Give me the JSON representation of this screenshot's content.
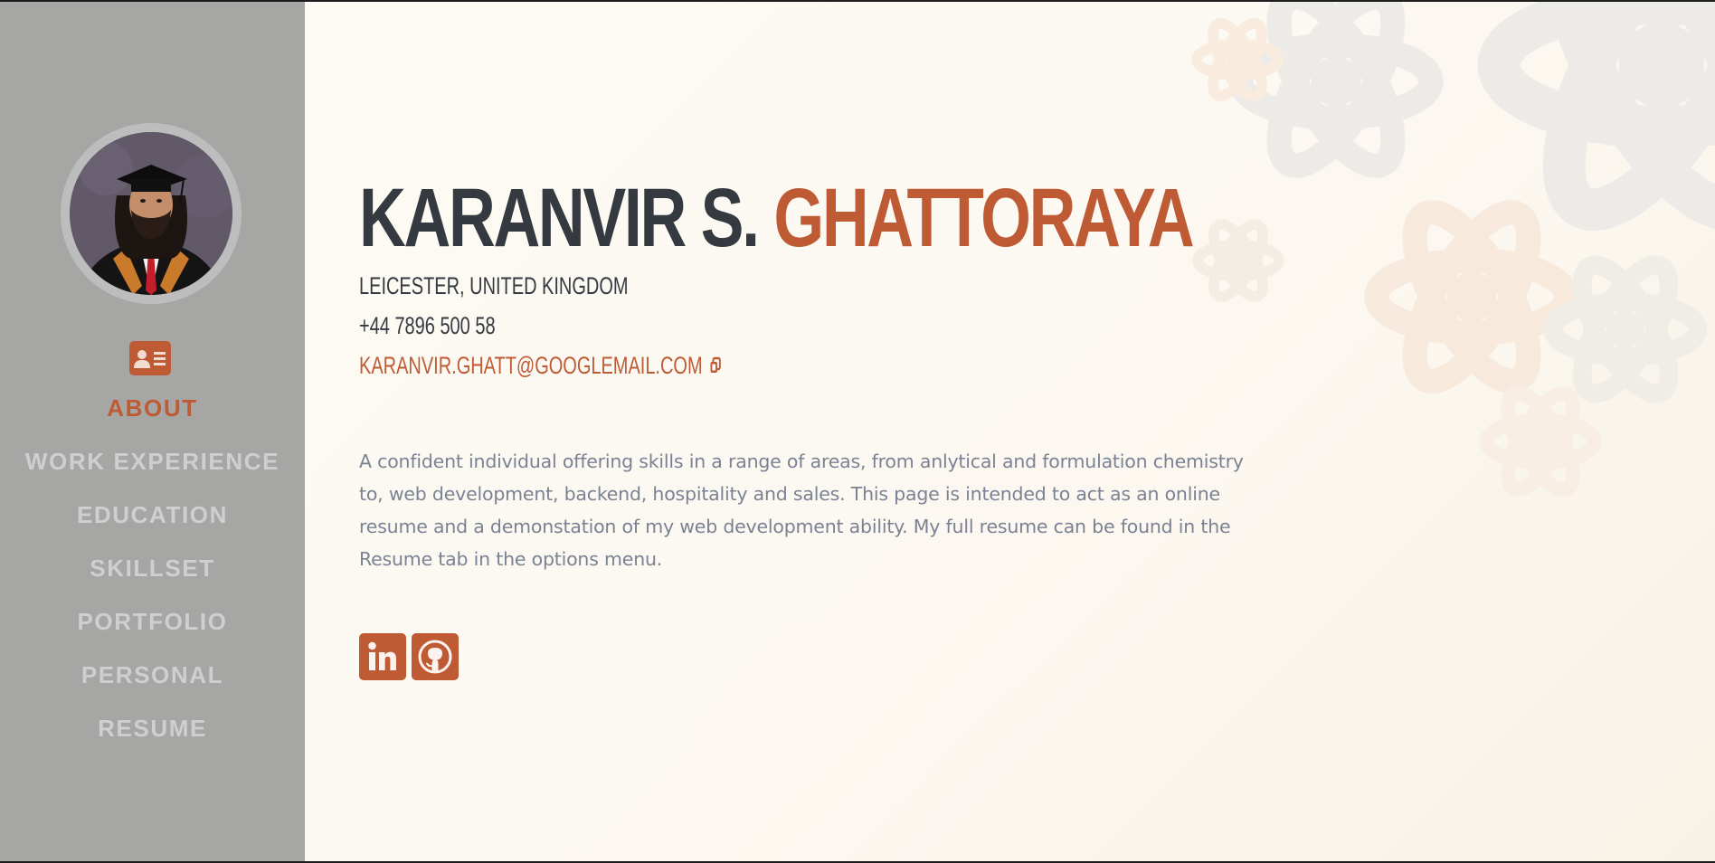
{
  "profile": {
    "first_name": "KARANVIR S.",
    "last_name": "GHATTORAYA",
    "location": "LEICESTER, UNITED KINGDOM",
    "phone": "+44 7896 500 58",
    "email": "KARANVIR.GHATT@GOOGLEMAIL.COM",
    "bio": "A confident individual offering skills in a range of areas, from anlytical and formulation chemistry to, web development, backend, hospitality and sales. This page is intended to act as an online resume and a demonstation of my web development ability. My full resume can be found in the Resume tab in the options menu."
  },
  "nav": {
    "items": [
      {
        "label": "ABOUT",
        "active": true
      },
      {
        "label": "WORK EXPERIENCE",
        "active": false
      },
      {
        "label": "EDUCATION",
        "active": false
      },
      {
        "label": "SKILLSET",
        "active": false
      },
      {
        "label": "PORTFOLIO",
        "active": false
      },
      {
        "label": "PERSONAL",
        "active": false
      },
      {
        "label": "RESUME",
        "active": false
      }
    ]
  },
  "icons": {
    "about": "id-card-icon",
    "copy": "copy-icon",
    "linkedin": "linkedin-icon",
    "github": "github-icon",
    "background": "atom-icon"
  },
  "colors": {
    "accent": "#bf5b34",
    "sidebar_bg": "#a6a6a5",
    "nav_text": "#cfcfcf",
    "heading": "#343a40",
    "body_text": "#7a8293",
    "page_bg": "#fdfaf4"
  }
}
